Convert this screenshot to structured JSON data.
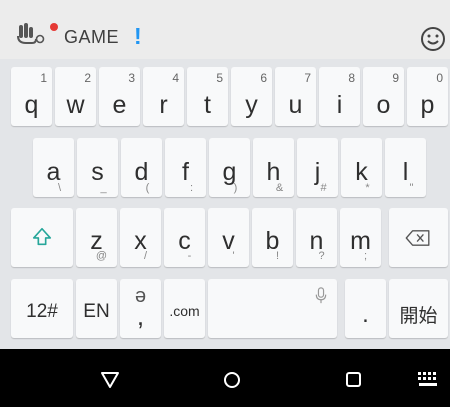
{
  "suggestion_bar": {
    "text": "GAME",
    "exclamation": "!",
    "icons": [
      "mic-hand-icon",
      "record-dot-icon",
      "emoji-smiley-icon"
    ]
  },
  "keyboard": {
    "row1": [
      {
        "main": "q",
        "sub": "1"
      },
      {
        "main": "w",
        "sub": "2"
      },
      {
        "main": "e",
        "sub": "3"
      },
      {
        "main": "r",
        "sub": "4"
      },
      {
        "main": "t",
        "sub": "5"
      },
      {
        "main": "y",
        "sub": "6"
      },
      {
        "main": "u",
        "sub": "7"
      },
      {
        "main": "i",
        "sub": "8"
      },
      {
        "main": "o",
        "sub": "9"
      },
      {
        "main": "p",
        "sub": "0"
      }
    ],
    "row2": [
      {
        "main": "a",
        "sub": "\\"
      },
      {
        "main": "s",
        "sub": "_"
      },
      {
        "main": "d",
        "sub": "("
      },
      {
        "main": "f",
        "sub": ":"
      },
      {
        "main": "g",
        "sub": ")"
      },
      {
        "main": "h",
        "sub": "&"
      },
      {
        "main": "j",
        "sub": "#"
      },
      {
        "main": "k",
        "sub": "*"
      },
      {
        "main": "l",
        "sub": "\""
      }
    ],
    "row3": [
      {
        "main": "z",
        "sub": "@"
      },
      {
        "main": "x",
        "sub": "/"
      },
      {
        "main": "c",
        "sub": "-"
      },
      {
        "main": "v",
        "sub": "'"
      },
      {
        "main": "b",
        "sub": "!"
      },
      {
        "main": "n",
        "sub": "?"
      },
      {
        "main": "m",
        "sub": ";"
      }
    ],
    "row4": {
      "numbers": "12#",
      "lang": "EN",
      "handwrite_top": "ə",
      "handwrite_bottom": ",",
      "dotcom": ".com",
      "period": ".",
      "go": "開始"
    },
    "accent_color": "#26a69a"
  },
  "navigation": {
    "icons": [
      "back-triangle-icon",
      "home-circle-icon",
      "recents-square-icon",
      "keyboard-switch-icon"
    ]
  }
}
